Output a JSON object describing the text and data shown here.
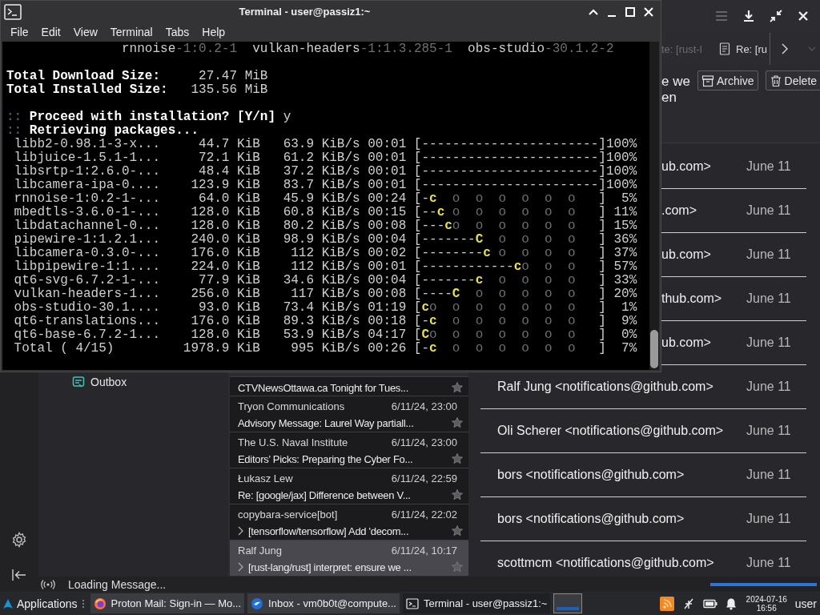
{
  "mail_app": {
    "folders": [
      {
        "label": "Outbox"
      }
    ],
    "message_list": {
      "items": [
        {
          "subject": "CTVNewsOttawa.ca Tonight for Tues...",
          "thread": false,
          "starred": false,
          "selected": false
        },
        {
          "sender": "Tryon Communications",
          "date": "6/11/24, 23:00",
          "subject": "Advisory Message: Laurel Way partiall...",
          "thread": false,
          "starred": false,
          "selected": false
        },
        {
          "sender": "The U.S. Naval Institute",
          "date": "6/11/24, 23:00",
          "subject": "Editors’ Picks: Preparing the Cyber Fo...",
          "thread": false,
          "starred": false,
          "selected": false
        },
        {
          "sender": "Łukasz Lew",
          "date": "6/11/24, 22:59",
          "subject": "Re: [google/jax] Difference between V...",
          "thread": false,
          "starred": false,
          "selected": false
        },
        {
          "sender": "copybara-service[bot]",
          "date": "6/11/24, 22:02",
          "subject": "[tensorflow/tensorflow] Add 'decom...",
          "thread": true,
          "starred": false,
          "selected": false
        },
        {
          "sender": "Ralf Jung",
          "date": "6/11/24, 10:17",
          "subject": "[rust-lang/rust] interpret: ensure we ...",
          "thread": true,
          "starred": false,
          "selected": true
        }
      ]
    },
    "reader": {
      "tabs": [
        {
          "label": "te: [rust-l",
          "kind": "faded"
        },
        {
          "label": "Re: [ru",
          "kind": "document"
        }
      ],
      "subject_lines": [
        "e we",
        "en"
      ],
      "buttons": [
        {
          "label": "Archive",
          "kind": "archive"
        },
        {
          "label": "Delete",
          "kind": "delete"
        }
      ],
      "covered_rows": [
        {
          "sender": "ub.com>",
          "date": "June 11"
        },
        {
          "sender": ".com>",
          "date": "June 11"
        },
        {
          "sender": "ub.com>",
          "date": "June 11"
        },
        {
          "sender": "thub.com>",
          "date": "June 11"
        },
        {
          "sender": "ub.com>",
          "date": "June 11"
        }
      ],
      "rows": [
        {
          "sender": "Ralf Jung <notifications@github.com>",
          "date": "June 11"
        },
        {
          "sender": "Oli Scherer <notifications@github.com>",
          "date": "June 11"
        },
        {
          "sender": "bors <notifications@github.com>",
          "date": "June 11"
        },
        {
          "sender": "bors <notifications@github.com>",
          "date": "June 11"
        },
        {
          "sender": "scottmcm <notifications@github.com>",
          "date": "June 11"
        }
      ]
    },
    "status_bar": {
      "text": "Loading Message...",
      "loading": {
        "level": 1
      }
    }
  },
  "terminal": {
    "title": "Terminal - user@passiz1:~",
    "menu": [
      "File",
      "Edit",
      "View",
      "Terminal",
      "Tabs",
      "Help"
    ],
    "lines": [
      {
        "kind": "packages",
        "packages": [
          {
            "name": "rnnoise",
            "version": "-1:0.2-1"
          },
          {
            "name": "vulkan-headers",
            "version": "-1:1.3.285-1"
          },
          {
            "name": "obs-studio",
            "version": "-30.1.2-2"
          }
        ]
      },
      {
        "kind": "blank"
      },
      {
        "kind": "summary",
        "label": "Total Download Size:",
        "value": "27.47 MiB"
      },
      {
        "kind": "summary",
        "label": "Total Installed Size:",
        "value": "135.56 MiB"
      },
      {
        "kind": "blank"
      },
      {
        "kind": "action",
        "marker": "::",
        "text": "Proceed with installation? [Y/n]",
        "answer": "y"
      },
      {
        "kind": "action",
        "marker": "::",
        "text": "Retrieving packages..."
      },
      {
        "kind": "progress",
        "name": "libb2-0.98.1-3-x...",
        "size": "44.7 KiB",
        "speed": "63.9 KiB/s",
        "eta": "00:01",
        "percent": "100%",
        "bar": {
          "track": "[-----------------------]"
        }
      },
      {
        "kind": "progress",
        "name": "libjuice-1.5.1-1...",
        "size": "72.1 KiB",
        "speed": "61.2 KiB/s",
        "eta": "00:01",
        "percent": "100%",
        "bar": {
          "track": "[-----------------------]"
        }
      },
      {
        "kind": "progress",
        "name": "libsrtp-1:2.6.0-...",
        "size": "48.4 KiB",
        "speed": "37.2 KiB/s",
        "eta": "00:01",
        "percent": "100%",
        "bar": {
          "track": "[-----------------------]"
        }
      },
      {
        "kind": "progress",
        "name": "libcamera-ipa-0....",
        "size": "123.9 KiB",
        "speed": "83.7 KiB/s",
        "eta": "00:01",
        "percent": "100%",
        "bar": {
          "track": "[-----------------------]"
        }
      },
      {
        "kind": "progress",
        "name": "rnnoise-1:0.2-1-...",
        "size": "64.0 KiB",
        "speed": "45.9 KiB/s",
        "eta": "00:24",
        "percent": "5%",
        "bar": {
          "track": "[-",
          "pacman": "c",
          "dots": "  o  o  o  o  o  o   ",
          "end": "]"
        }
      },
      {
        "kind": "progress",
        "name": "mbedtls-3.6.0-1-...",
        "size": "128.0 KiB",
        "speed": "60.8 KiB/s",
        "eta": "00:15",
        "percent": "11%",
        "bar": {
          "track": "[--",
          "pacman": "c",
          "dots": " o  o  o  o  o  o   ",
          "end": "]"
        }
      },
      {
        "kind": "progress",
        "name": "libdatachannel-0...",
        "size": "128.0 KiB",
        "speed": "80.2 KiB/s",
        "eta": "00:08",
        "percent": "15%",
        "bar": {
          "track": "[---",
          "pacman": "c",
          "dots": "o  o  o  o  o  o   ",
          "end": "]"
        }
      },
      {
        "kind": "progress",
        "name": "pipewire-1:1.2.1...",
        "size": "240.0 KiB",
        "speed": "98.9 KiB/s",
        "eta": "00:04",
        "percent": "36%",
        "bar": {
          "track": "[-------",
          "pacman": "C",
          "dots": "  o  o  o  o   ",
          "end": "]"
        }
      },
      {
        "kind": "progress",
        "name": "libcamera-0.3.0-...",
        "size": "176.0 KiB",
        "speed": "112 KiB/s",
        "eta": "00:02",
        "percent": "37%",
        "bar": {
          "track": "[--------",
          "pacman": "c",
          "dots": " o  o  o  o   ",
          "end": "]"
        }
      },
      {
        "kind": "progress",
        "name": "libpipewire-1:1....",
        "size": "224.0 KiB",
        "speed": "112 KiB/s",
        "eta": "00:01",
        "percent": "57%",
        "bar": {
          "track": "[------------",
          "pacman": "c",
          "dots": "o  o  o   ",
          "end": "]"
        }
      },
      {
        "kind": "progress",
        "name": "qt6-svg-6.7.2-1-...",
        "size": "77.9 KiB",
        "speed": "34.6 KiB/s",
        "eta": "00:04",
        "percent": "33%",
        "bar": {
          "track": "[-------",
          "pacman": "c",
          "dots": "  o  o  o  o   ",
          "end": "]"
        }
      },
      {
        "kind": "progress",
        "name": "vulkan-headers-1...",
        "size": "256.0 KiB",
        "speed": "117 KiB/s",
        "eta": "00:08",
        "percent": "20%",
        "bar": {
          "track": "[----",
          "pacman": "C",
          "dots": "  o  o  o  o  o   ",
          "end": "]"
        }
      },
      {
        "kind": "progress",
        "name": "obs-studio-30.1....",
        "size": "93.0 KiB",
        "speed": "73.4 KiB/s",
        "eta": "01:19",
        "percent": "1%",
        "bar": {
          "track": "[",
          "pacman": "c",
          "dots": "o  o  o  o  o  o  o   ",
          "end": "]"
        }
      },
      {
        "kind": "progress",
        "name": "qt6-translations...",
        "size": "176.0 KiB",
        "speed": "89.3 KiB/s",
        "eta": "00:18",
        "percent": "9%",
        "bar": {
          "track": "[-",
          "pacman": "c",
          "dots": "  o  o  o  o  o  o   ",
          "end": "]"
        }
      },
      {
        "kind": "progress",
        "name": "qt6-base-6.7.2-1...",
        "size": "128.0 KiB",
        "speed": "53.9 KiB/s",
        "eta": "04:17",
        "percent": "0%",
        "bar": {
          "track": "[",
          "pacman": "C",
          "dots": "o  o  o  o  o  o  o   ",
          "end": "]"
        }
      },
      {
        "kind": "progress",
        "name": "Total ( 4/15)",
        "size": "1978.9 KiB",
        "speed": "995 KiB/s",
        "eta": "00:26",
        "percent": "7%",
        "bar": {
          "track": "[-",
          "pacman": "c",
          "dots": "  o  o  o  o  o  o   ",
          "end": "]"
        }
      }
    ]
  },
  "taskbar": {
    "menu_label": "Applications",
    "tasks": [
      {
        "label": "Proton Mail: Sign-in — Mo...",
        "kind": "browser",
        "selected": false
      },
      {
        "label": "Inbox - vm0b0t@compute...",
        "kind": "mail",
        "selected": false
      },
      {
        "label": "Terminal - user@passiz1:~",
        "kind": "terminal",
        "selected": true
      }
    ],
    "date": "2024-07-16",
    "time": "16:56",
    "user": "user"
  }
}
